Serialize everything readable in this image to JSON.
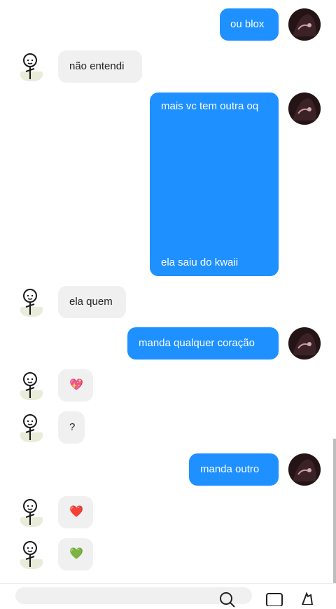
{
  "messages": [
    {
      "side": "out",
      "text": "ou blox"
    },
    {
      "side": "in",
      "text": "não entendi"
    },
    {
      "side": "out",
      "text": "mais vc tem outra oq",
      "text2": "ela saiu do kwaii"
    },
    {
      "side": "in",
      "text": "ela quem"
    },
    {
      "side": "out",
      "text": "manda qualquer coração"
    },
    {
      "side": "in",
      "text": "💖"
    },
    {
      "side": "in",
      "text": "?"
    },
    {
      "side": "out",
      "text": "manda outro"
    },
    {
      "side": "in",
      "text": "❤️"
    },
    {
      "side": "in",
      "text": "💚"
    }
  ],
  "composer": {
    "search_icon": "search-icon",
    "icons": [
      "image-icon",
      "like-icon"
    ]
  },
  "colors": {
    "outgoing_bubble": "#1e90ff",
    "incoming_bubble": "#f0f0f1"
  }
}
